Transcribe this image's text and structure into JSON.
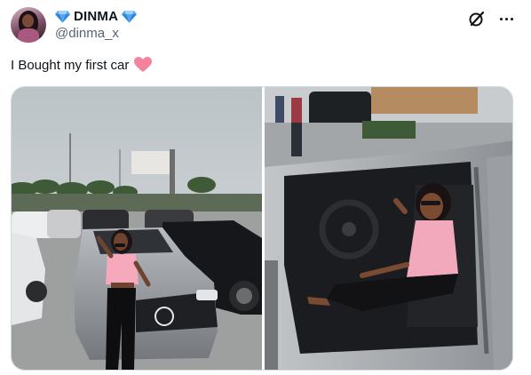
{
  "user": {
    "display_name": "DINMA",
    "handle": "@dinma_x",
    "verified_icon": "diamond-icon"
  },
  "tweet": {
    "text": "I Bought my first car",
    "emoji": "pink-heart-icon"
  },
  "media": {
    "images": [
      {
        "name": "photo-woman-posing-front-of-car",
        "depicts": "woman posing in front of silver car at car lot"
      },
      {
        "name": "photo-woman-sitting-in-car",
        "depicts": "woman sitting in driver seat of silver car"
      }
    ]
  },
  "colors": {
    "text_primary": "#0f1419",
    "text_secondary": "#536471",
    "diamond": "#58a6ee",
    "heart": "#f4829d",
    "border": "#cfd9de"
  },
  "icons": {
    "grok": "grok-icon",
    "more": "more-icon"
  }
}
